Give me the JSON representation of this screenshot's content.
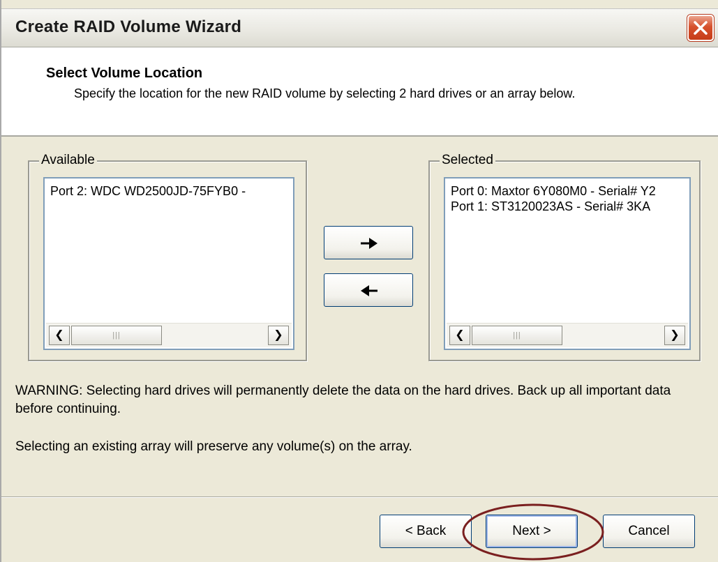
{
  "window": {
    "title": "Create RAID Volume Wizard",
    "close_icon": "close-icon"
  },
  "header": {
    "title": "Select Volume Location",
    "description": "Specify the location for the new RAID volume by selecting 2 hard drives or an array below."
  },
  "available": {
    "legend": "Available",
    "items": [
      "Port 2: WDC WD2500JD-75FYB0 -"
    ]
  },
  "selected": {
    "legend": "Selected",
    "items": [
      "Port 0: Maxtor 6Y080M0 - Serial# Y2",
      "Port 1: ST3120023AS - Serial# 3KA"
    ]
  },
  "transfer": {
    "add_icon": "arrow-right-icon",
    "remove_icon": "arrow-left-icon"
  },
  "messages": {
    "warning": "WARNING: Selecting hard drives will permanently delete the data on the hard drives. Back up all important data before continuing.",
    "info": "Selecting an existing array will preserve any volume(s) on the array."
  },
  "buttons": {
    "back": "< Back",
    "next": "Next >",
    "cancel": "Cancel"
  },
  "annotation": {
    "color": "#7a1f1f"
  }
}
